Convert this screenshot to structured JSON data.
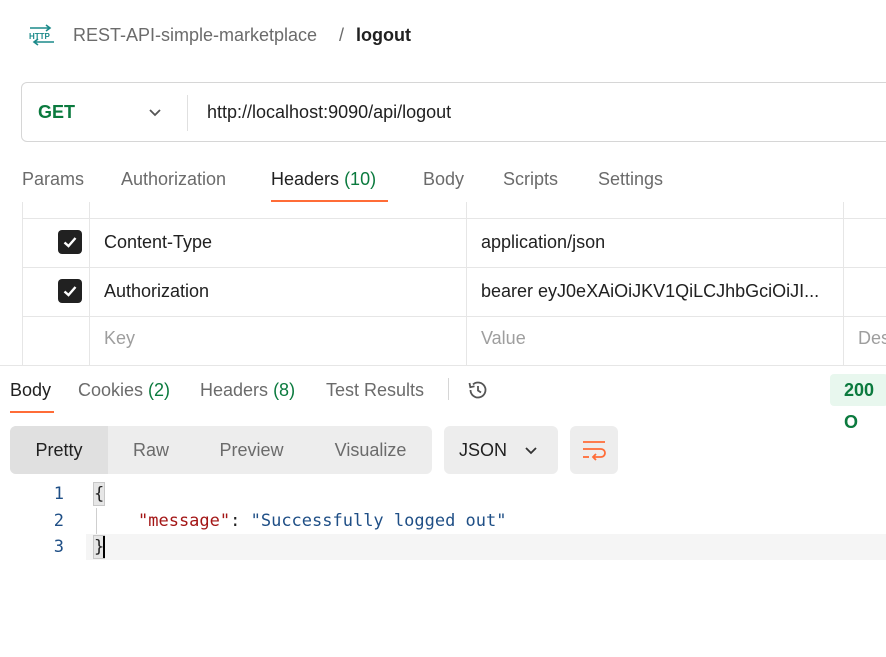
{
  "breadcrumb": {
    "collection": "REST-API-simple-marketplace",
    "separator": "/",
    "current": "logout"
  },
  "request": {
    "method": "GET",
    "url": "http://localhost:9090/api/logout"
  },
  "request_tabs": [
    {
      "label": "Params",
      "count": ""
    },
    {
      "label": "Authorization",
      "count": ""
    },
    {
      "label": "Headers",
      "count": "(10)",
      "active": true
    },
    {
      "label": "Body",
      "count": ""
    },
    {
      "label": "Scripts",
      "count": ""
    },
    {
      "label": "Settings",
      "count": ""
    }
  ],
  "headers_table": {
    "rows": [
      {
        "key": "Content-Type",
        "value": "application/json",
        "checked": true
      },
      {
        "key": "Authorization",
        "value": "bearer eyJ0eXAiOiJKV1QiLCJhbGciOiJI...",
        "checked": true
      }
    ],
    "placeholder": {
      "key": "Key",
      "value": "Value",
      "description": "Des"
    }
  },
  "response_tabs": [
    {
      "label": "Body",
      "count": "",
      "active": true
    },
    {
      "label": "Cookies",
      "count": "(2)"
    },
    {
      "label": "Headers",
      "count": "(8)"
    },
    {
      "label": "Test Results",
      "count": ""
    }
  ],
  "status": "200 O",
  "view_modes": [
    "Pretty",
    "Raw",
    "Preview",
    "Visualize"
  ],
  "format": "JSON",
  "response_body": {
    "line_numbers": [
      "1",
      "2",
      "3"
    ],
    "open_brace": "{",
    "key": "\"message\"",
    "colon": ": ",
    "value": "\"Successfully logged out\"",
    "close_brace": "}"
  },
  "colors": {
    "accent": "#ff6c37",
    "method_get": "#0b7a3e",
    "status_ok_bg": "#e8f7ee"
  },
  "icons": [
    "http-icon",
    "chevron-down-icon",
    "checkbox-checked-icon",
    "history-icon",
    "wrap-lines-icon"
  ]
}
